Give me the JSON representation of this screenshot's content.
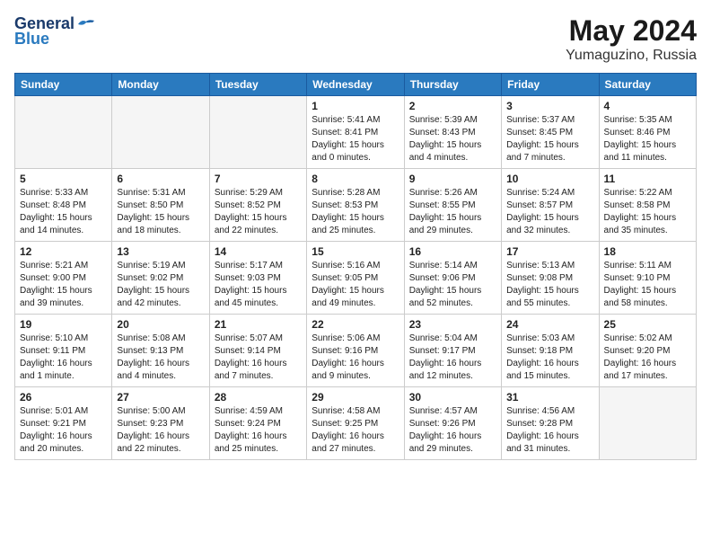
{
  "header": {
    "logo_general": "General",
    "logo_blue": "Blue",
    "month_year": "May 2024",
    "location": "Yumaguzino, Russia"
  },
  "weekdays": [
    "Sunday",
    "Monday",
    "Tuesday",
    "Wednesday",
    "Thursday",
    "Friday",
    "Saturday"
  ],
  "weeks": [
    [
      {
        "day": "",
        "empty": true
      },
      {
        "day": "",
        "empty": true
      },
      {
        "day": "",
        "empty": true
      },
      {
        "day": "1",
        "sunrise": "5:41 AM",
        "sunset": "8:41 PM",
        "daylight": "15 hours and 0 minutes."
      },
      {
        "day": "2",
        "sunrise": "5:39 AM",
        "sunset": "8:43 PM",
        "daylight": "15 hours and 4 minutes."
      },
      {
        "day": "3",
        "sunrise": "5:37 AM",
        "sunset": "8:45 PM",
        "daylight": "15 hours and 7 minutes."
      },
      {
        "day": "4",
        "sunrise": "5:35 AM",
        "sunset": "8:46 PM",
        "daylight": "15 hours and 11 minutes."
      }
    ],
    [
      {
        "day": "5",
        "sunrise": "5:33 AM",
        "sunset": "8:48 PM",
        "daylight": "15 hours and 14 minutes."
      },
      {
        "day": "6",
        "sunrise": "5:31 AM",
        "sunset": "8:50 PM",
        "daylight": "15 hours and 18 minutes."
      },
      {
        "day": "7",
        "sunrise": "5:29 AM",
        "sunset": "8:52 PM",
        "daylight": "15 hours and 22 minutes."
      },
      {
        "day": "8",
        "sunrise": "5:28 AM",
        "sunset": "8:53 PM",
        "daylight": "15 hours and 25 minutes."
      },
      {
        "day": "9",
        "sunrise": "5:26 AM",
        "sunset": "8:55 PM",
        "daylight": "15 hours and 29 minutes."
      },
      {
        "day": "10",
        "sunrise": "5:24 AM",
        "sunset": "8:57 PM",
        "daylight": "15 hours and 32 minutes."
      },
      {
        "day": "11",
        "sunrise": "5:22 AM",
        "sunset": "8:58 PM",
        "daylight": "15 hours and 35 minutes."
      }
    ],
    [
      {
        "day": "12",
        "sunrise": "5:21 AM",
        "sunset": "9:00 PM",
        "daylight": "15 hours and 39 minutes."
      },
      {
        "day": "13",
        "sunrise": "5:19 AM",
        "sunset": "9:02 PM",
        "daylight": "15 hours and 42 minutes."
      },
      {
        "day": "14",
        "sunrise": "5:17 AM",
        "sunset": "9:03 PM",
        "daylight": "15 hours and 45 minutes."
      },
      {
        "day": "15",
        "sunrise": "5:16 AM",
        "sunset": "9:05 PM",
        "daylight": "15 hours and 49 minutes."
      },
      {
        "day": "16",
        "sunrise": "5:14 AM",
        "sunset": "9:06 PM",
        "daylight": "15 hours and 52 minutes."
      },
      {
        "day": "17",
        "sunrise": "5:13 AM",
        "sunset": "9:08 PM",
        "daylight": "15 hours and 55 minutes."
      },
      {
        "day": "18",
        "sunrise": "5:11 AM",
        "sunset": "9:10 PM",
        "daylight": "15 hours and 58 minutes."
      }
    ],
    [
      {
        "day": "19",
        "sunrise": "5:10 AM",
        "sunset": "9:11 PM",
        "daylight": "16 hours and 1 minute."
      },
      {
        "day": "20",
        "sunrise": "5:08 AM",
        "sunset": "9:13 PM",
        "daylight": "16 hours and 4 minutes."
      },
      {
        "day": "21",
        "sunrise": "5:07 AM",
        "sunset": "9:14 PM",
        "daylight": "16 hours and 7 minutes."
      },
      {
        "day": "22",
        "sunrise": "5:06 AM",
        "sunset": "9:16 PM",
        "daylight": "16 hours and 9 minutes."
      },
      {
        "day": "23",
        "sunrise": "5:04 AM",
        "sunset": "9:17 PM",
        "daylight": "16 hours and 12 minutes."
      },
      {
        "day": "24",
        "sunrise": "5:03 AM",
        "sunset": "9:18 PM",
        "daylight": "16 hours and 15 minutes."
      },
      {
        "day": "25",
        "sunrise": "5:02 AM",
        "sunset": "9:20 PM",
        "daylight": "16 hours and 17 minutes."
      }
    ],
    [
      {
        "day": "26",
        "sunrise": "5:01 AM",
        "sunset": "9:21 PM",
        "daylight": "16 hours and 20 minutes."
      },
      {
        "day": "27",
        "sunrise": "5:00 AM",
        "sunset": "9:23 PM",
        "daylight": "16 hours and 22 minutes."
      },
      {
        "day": "28",
        "sunrise": "4:59 AM",
        "sunset": "9:24 PM",
        "daylight": "16 hours and 25 minutes."
      },
      {
        "day": "29",
        "sunrise": "4:58 AM",
        "sunset": "9:25 PM",
        "daylight": "16 hours and 27 minutes."
      },
      {
        "day": "30",
        "sunrise": "4:57 AM",
        "sunset": "9:26 PM",
        "daylight": "16 hours and 29 minutes."
      },
      {
        "day": "31",
        "sunrise": "4:56 AM",
        "sunset": "9:28 PM",
        "daylight": "16 hours and 31 minutes."
      },
      {
        "day": "",
        "empty": true
      }
    ]
  ],
  "labels": {
    "sunrise": "Sunrise:",
    "sunset": "Sunset:",
    "daylight": "Daylight:"
  }
}
